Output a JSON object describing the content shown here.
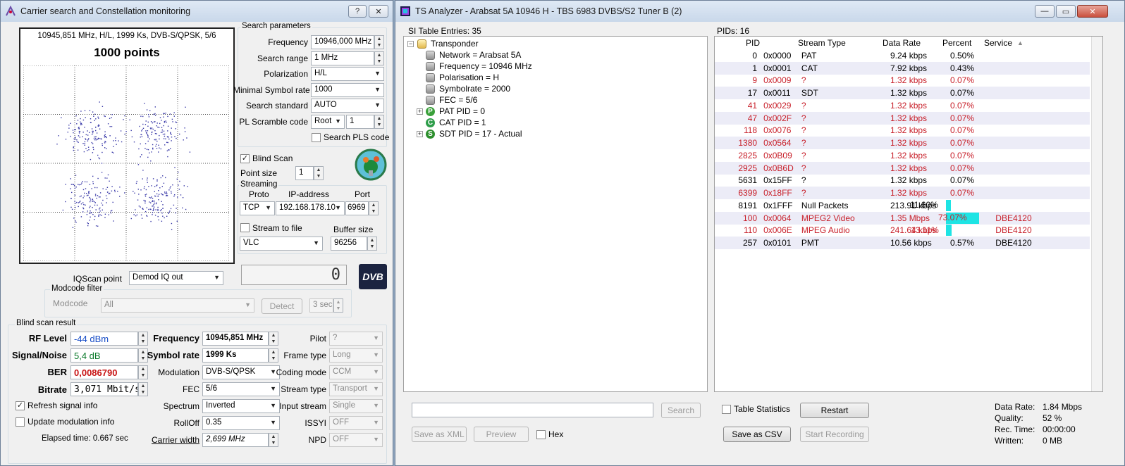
{
  "left_window": {
    "title": "Carrier search and Constellation monitoring",
    "help_btn": "?",
    "close_btn": "✕",
    "constellation": {
      "info": "10945,851 MHz, H/L, 1999 Ks, DVB-S/QPSK, 5/6",
      "points_title": "1000 points"
    },
    "search": {
      "group": "Search parameters",
      "frequency_label": "Frequency",
      "frequency": "10946,000 MHz",
      "range_label": "Search range",
      "range": "1 MHz",
      "polarization_label": "Polarization",
      "polarization": "H/L",
      "minsr_label": "Minimal Symbol rate",
      "minsr": "1000",
      "standard_label": "Search standard",
      "standard": "AUTO",
      "pls_label": "PL Scramble code",
      "pls_mode": "Root",
      "pls_value": "1",
      "search_pls_label": "Search PLS code",
      "blind_scan_label": "Blind Scan",
      "blind_scan_mark": "✓",
      "point_size_label": "Point size",
      "point_size": "1"
    },
    "streaming": {
      "group": "Streaming",
      "proto_label": "Proto",
      "ip_label": "IP-address",
      "port_label": "Port",
      "proto": "TCP",
      "ip": "192.168.178.10",
      "port": "6969",
      "to_file_label": "Stream to file",
      "buffer_label": "Buffer size",
      "player": "VLC",
      "buffer": "96256"
    },
    "iq": {
      "label": "IQScan point",
      "value": "Demod IQ out",
      "counter": "0",
      "logo": "DVB"
    },
    "modcode": {
      "group": "Modcode filter",
      "label": "Modcode",
      "value": "All",
      "detect": "Detect",
      "time": "3 sec"
    },
    "result": {
      "group": "Blind scan result",
      "rf_label": "RF Level",
      "rf": "-44 dBm",
      "snr_label": "Signal/Noise",
      "snr": "5,4 dB",
      "ber_label": "BER",
      "ber": "0,0086790",
      "bitrate_label": "Bitrate",
      "bitrate": "3,071 Mbit/s",
      "freq_label": "Frequency",
      "freq": "10945,851 MHz",
      "sr_label": "Symbol rate",
      "sr": "1999 Ks",
      "mod_label": "Modulation",
      "mod": "DVB-S/QPSK",
      "fec_label": "FEC",
      "fec": "5/6",
      "spectrum_label": "Spectrum",
      "spectrum": "Inverted",
      "rolloff_label": "RollOff",
      "rolloff": "0.35",
      "cw_label": "Carrier width",
      "cw": "2,699 MHz",
      "pilot_label": "Pilot",
      "pilot": "?",
      "frame_label": "Frame type",
      "frame": "Long",
      "coding_label": "Coding mode",
      "coding": "CCM",
      "stype_label": "Stream type",
      "stype": "Transport",
      "istream_label": "Input stream",
      "istream": "Single",
      "issyi_label": "ISSYI",
      "issyi": "OFF",
      "npd_label": "NPD",
      "npd": "OFF",
      "refresh_label": "Refresh signal info",
      "refresh_mark": "✓",
      "update_label": "Update modulation info",
      "elapsed": "Elapsed time: 0.667 sec"
    }
  },
  "right_window": {
    "title": "TS Analyzer - Arabsat 5A  10946 H - TBS 6983 DVBS/S2 Tuner B (2)",
    "si_label": "SI Table Entries: 35",
    "tree": {
      "root": "Transponder",
      "items": [
        "Network = Arabsat 5A",
        "Frequency = 10946 MHz",
        "Polarisation = H",
        "Symbolrate = 2000",
        "FEC = 5/6"
      ],
      "pat": "PAT PID = 0",
      "cat": "CAT PID = 1",
      "sdt": "SDT PID = 17 - Actual",
      "p": "P",
      "c": "C",
      "s": "S",
      "plus": "+"
    },
    "search_btn": "Search",
    "save_xml": "Save as XML",
    "preview": "Preview",
    "hex": "Hex",
    "pids_label": "PIDs: 16",
    "columns": [
      "PID",
      "Stream Type",
      "Data Rate",
      "Percent",
      "Service"
    ],
    "sort_arrow": "▲",
    "rows": [
      {
        "pid": "0",
        "hex": "0x0000",
        "type": "PAT",
        "rate": "9.24 kbps",
        "pct": "0.50%",
        "svc": "",
        "red": false,
        "bar": 0
      },
      {
        "pid": "1",
        "hex": "0x0001",
        "type": "CAT",
        "rate": "7.92 kbps",
        "pct": "0.43%",
        "svc": "",
        "red": false,
        "bar": 0
      },
      {
        "pid": "9",
        "hex": "0x0009",
        "type": "?",
        "rate": "1.32 kbps",
        "pct": "0.07%",
        "svc": "",
        "red": true,
        "bar": 0
      },
      {
        "pid": "17",
        "hex": "0x0011",
        "type": "SDT",
        "rate": "1.32 kbps",
        "pct": "0.07%",
        "svc": "",
        "red": false,
        "bar": 0
      },
      {
        "pid": "41",
        "hex": "0x0029",
        "type": "?",
        "rate": "1.32 kbps",
        "pct": "0.07%",
        "svc": "",
        "red": true,
        "bar": 0
      },
      {
        "pid": "47",
        "hex": "0x002F",
        "type": "?",
        "rate": "1.32 kbps",
        "pct": "0.07%",
        "svc": "",
        "red": true,
        "bar": 0
      },
      {
        "pid": "118",
        "hex": "0x0076",
        "type": "?",
        "rate": "1.32 kbps",
        "pct": "0.07%",
        "svc": "",
        "red": true,
        "bar": 0
      },
      {
        "pid": "1380",
        "hex": "0x0564",
        "type": "?",
        "rate": "1.32 kbps",
        "pct": "0.07%",
        "svc": "",
        "red": true,
        "bar": 0
      },
      {
        "pid": "2825",
        "hex": "0x0B09",
        "type": "?",
        "rate": "1.32 kbps",
        "pct": "0.07%",
        "svc": "",
        "red": true,
        "bar": 0
      },
      {
        "pid": "2925",
        "hex": "0x0B6D",
        "type": "?",
        "rate": "1.32 kbps",
        "pct": "0.07%",
        "svc": "",
        "red": true,
        "bar": 0
      },
      {
        "pid": "5631",
        "hex": "0x15FF",
        "type": "?",
        "rate": "1.32 kbps",
        "pct": "0.07%",
        "svc": "",
        "red": false,
        "bar": 0
      },
      {
        "pid": "6399",
        "hex": "0x18FF",
        "type": "?",
        "rate": "1.32 kbps",
        "pct": "0.07%",
        "svc": "",
        "red": true,
        "bar": 0
      },
      {
        "pid": "8191",
        "hex": "0x1FFF",
        "type": "Null Packets",
        "rate": "213.91 kbps",
        "pct": "11.60%",
        "svc": "",
        "red": false,
        "bar": 0.116
      },
      {
        "pid": "100",
        "hex": "0x0064",
        "type": "MPEG2 Video",
        "rate": "1.35 Mbps",
        "pct": "73.07%",
        "svc": "DBE4120",
        "red": true,
        "bar": 0.7307
      },
      {
        "pid": "110",
        "hex": "0x006E",
        "type": "MPEG Audio",
        "rate": "241.64 kbps",
        "pct": "13.11%",
        "svc": "DBE4120",
        "red": true,
        "bar": 0.1311
      },
      {
        "pid": "257",
        "hex": "0x0101",
        "type": "PMT",
        "rate": "10.56 kbps",
        "pct": "0.57%",
        "svc": "DBE4120",
        "red": false,
        "bar": 0
      }
    ],
    "table_stats": "Table Statistics",
    "restart": "Restart",
    "save_csv": "Save as CSV",
    "start_rec": "Start Recording",
    "stats": {
      "rate_label": "Data Rate:",
      "rate": "1.84 Mbps",
      "quality_label": "Quality:",
      "quality": "52 %",
      "rec_label": "Rec. Time:",
      "rec": "00:00:00",
      "written_label": "Written:",
      "written": "0 MB"
    },
    "min_btn": "—",
    "max_btn": "▭",
    "close_btn": "✕"
  }
}
